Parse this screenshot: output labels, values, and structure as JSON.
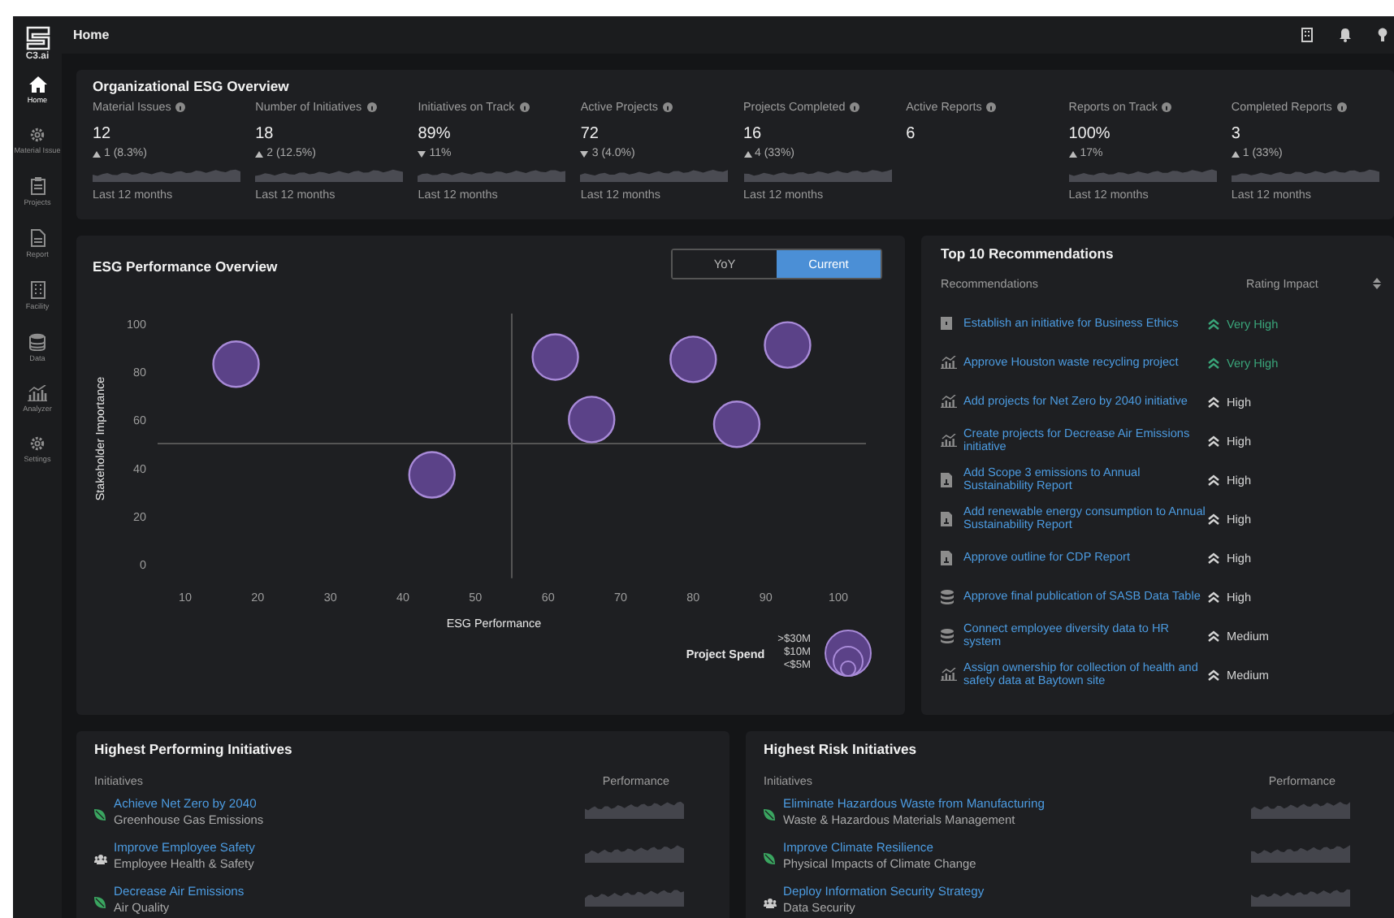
{
  "sidebar": {
    "logo": "C3.ai",
    "items": [
      {
        "label": "Home",
        "kind": "home",
        "selected": true
      },
      {
        "label": "Material Issue",
        "kind": "gear",
        "selected": false
      },
      {
        "label": "Projects",
        "kind": "clipboard",
        "selected": false
      },
      {
        "label": "Report",
        "kind": "document",
        "selected": false
      },
      {
        "label": "Facility",
        "kind": "building",
        "selected": false
      },
      {
        "label": "Data",
        "kind": "database",
        "selected": false
      },
      {
        "label": "Analyzer",
        "kind": "chart",
        "selected": false
      },
      {
        "label": "Settings",
        "kind": "gear",
        "selected": false
      }
    ]
  },
  "header": {
    "title": "Home"
  },
  "overview": {
    "title": "Organizational ESG Overview",
    "metrics": [
      {
        "label": "Material Issues",
        "value": "12",
        "kind": "up",
        "change": "1 (8.3%)",
        "period": "Last 12 months"
      },
      {
        "label": "Number of Initiatives",
        "value": "18",
        "kind": "up",
        "change": "2 (12.5%)",
        "period": "Last 12 months"
      },
      {
        "label": "Initiatives on Track",
        "value": "89%",
        "kind": "down",
        "change": "11%",
        "period": "Last 12 months"
      },
      {
        "label": "Active Projects",
        "value": "72",
        "kind": "down",
        "change": "3 (4.0%)",
        "period": "Last 12 months"
      },
      {
        "label": "Projects Completed",
        "value": "16",
        "kind": "up",
        "change": "4 (33%)",
        "period": "Last 12 months"
      },
      {
        "label": "Active Reports",
        "value": "6"
      },
      {
        "label": "Reports on Track",
        "value": "100%",
        "kind": "up",
        "change": "17%",
        "period": "Last 12 months"
      },
      {
        "label": "Completed Reports",
        "value": "3",
        "kind": "up",
        "change": "1 (33%)",
        "period": "Last 12 months"
      }
    ]
  },
  "performance": {
    "title": "ESG Performance Overview",
    "toggle": [
      {
        "label": "YoY",
        "selected": false
      },
      {
        "label": "Current",
        "selected": true
      }
    ],
    "chart_data": {
      "type": "scatter",
      "xlabel": "ESG Performance",
      "ylabel": "Stakeholder Importance",
      "x": [
        17,
        44,
        61,
        66,
        80,
        86,
        93
      ],
      "series": [
        {
          "color": "#5b4288",
          "values": [
            83,
            37,
            86,
            60,
            85,
            58,
            91
          ]
        }
      ],
      "xlim": [
        10,
        100
      ],
      "ylim": [
        0,
        100
      ],
      "xticks": [
        10,
        20,
        30,
        40,
        50,
        60,
        70,
        80,
        90,
        100
      ],
      "yticks": [
        0,
        20,
        40,
        60,
        80,
        100
      ],
      "ref_lines": [
        {
          "axis": "x",
          "value": 55
        },
        {
          "axis": "y",
          "value": 50
        }
      ]
    },
    "legend": {
      "title": "Project Spend",
      "sizes": [
        ">$30M",
        "$10M",
        "<$5M"
      ]
    }
  },
  "recommendations": {
    "title": "Top 10 Recommendations",
    "columns": [
      "Recommendations",
      "Rating Impact"
    ],
    "rows": [
      {
        "kind": "building",
        "text": "Establish an initiative for Business Ethics",
        "rating": "Very High",
        "color": "#3aa57a"
      },
      {
        "kind": "chart",
        "text": "Approve Houston waste recycling project",
        "rating": "Very High",
        "color": "#3aa57a"
      },
      {
        "kind": "chart",
        "text": "Add projects for Net Zero by 2040 initiative",
        "rating": "High",
        "color": "#d4d4d4"
      },
      {
        "kind": "chart",
        "text": "Create projects for Decrease Air Emissions initiative",
        "rating": "High",
        "color": "#d4d4d4"
      },
      {
        "kind": "document",
        "text": "Add Scope 3 emissions to Annual Sustainability Report",
        "rating": "High",
        "color": "#d4d4d4"
      },
      {
        "kind": "document",
        "text": "Add renewable energy consumption to Annual Sustainability Report",
        "rating": "High",
        "color": "#d4d4d4"
      },
      {
        "kind": "document",
        "text": "Approve outline for CDP Report",
        "rating": "High",
        "color": "#d4d4d4"
      },
      {
        "kind": "database",
        "text": "Approve final publication of SASB Data Table",
        "rating": "High",
        "color": "#d4d4d4"
      },
      {
        "kind": "database",
        "text": "Connect employee diversity data to HR system",
        "rating": "Medium",
        "color": "#d4d4d4"
      },
      {
        "kind": "chart",
        "text": "Assign ownership for collection of health and safety data at Baytown site",
        "rating": "Medium",
        "color": "#d4d4d4"
      }
    ]
  },
  "initiative_panels": [
    {
      "title": "Highest Performing Initiatives",
      "columns": [
        "Initiatives",
        "Performance"
      ],
      "rows": [
        {
          "kind": "leaf",
          "name": "Achieve Net Zero by 2040",
          "category": "Greenhouse Gas Emissions"
        },
        {
          "kind": "people",
          "name": "Improve Employee Safety",
          "category": "Employee Health & Safety"
        },
        {
          "kind": "leaf",
          "name": "Decrease Air Emissions",
          "category": "Air Quality"
        }
      ]
    },
    {
      "title": "Highest Risk Initiatives",
      "columns": [
        "Initiatives",
        "Performance"
      ],
      "rows": [
        {
          "kind": "leaf",
          "name": "Eliminate Hazardous Waste from Manufacturing",
          "category": "Waste & Hazardous Materials Management"
        },
        {
          "kind": "leaf",
          "name": "Improve Climate Resilience",
          "category": "Physical Impacts of Climate Change"
        },
        {
          "kind": "people",
          "name": "Deploy Information Security Strategy",
          "category": "Data Security"
        }
      ]
    }
  ]
}
